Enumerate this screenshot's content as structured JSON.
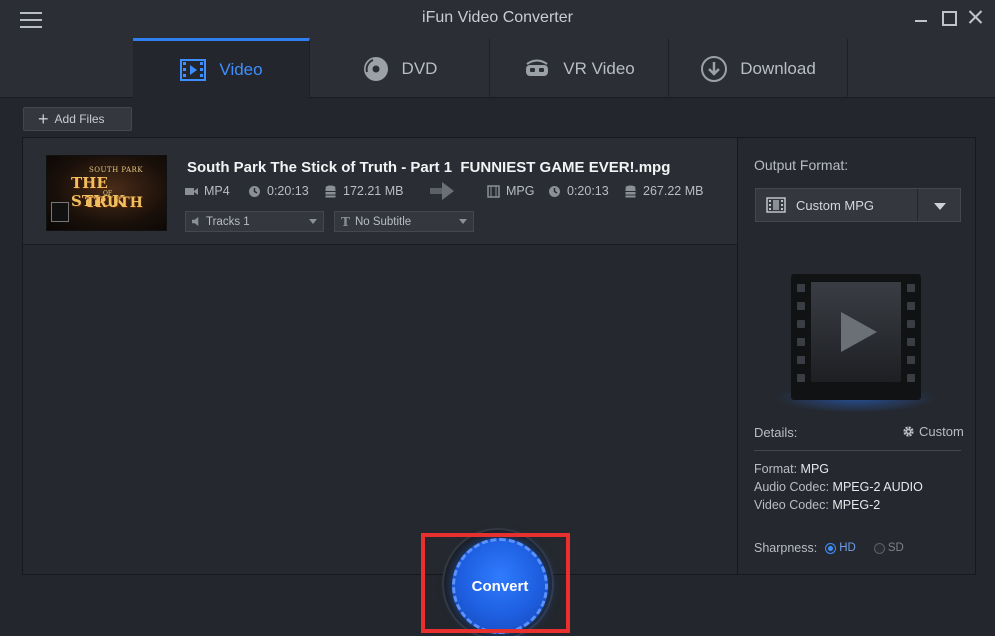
{
  "window": {
    "title": "iFun Video Converter"
  },
  "tabs": [
    {
      "label": "Video",
      "icon": "film-icon",
      "active": true
    },
    {
      "label": "DVD",
      "icon": "disc-icon"
    },
    {
      "label": "VR Video",
      "icon": "vr-headset-icon"
    },
    {
      "label": "Download",
      "icon": "download-icon"
    }
  ],
  "toolbar": {
    "add_files_label": "Add Files"
  },
  "file": {
    "name": "South Park The Stick of Truth - Part 1  FUNNIEST GAME EVER!.mpg",
    "thumbnail_text": [
      "SOUTH PARK",
      "THE STICK",
      "OF",
      "TRUTH"
    ],
    "source": {
      "format": "MP4",
      "duration": "0:20:13",
      "size": "172.21 MB"
    },
    "target": {
      "format": "MPG",
      "duration": "0:20:13",
      "size": "267.22 MB"
    },
    "audio_track": "Tracks 1",
    "subtitle": "No Subtitle"
  },
  "output": {
    "label": "Output Format:",
    "selected": "Custom MPG",
    "details_label": "Details:",
    "custom_label": "Custom",
    "format_key": "Format:",
    "format_value": "MPG",
    "audio_codec_key": "Audio Codec:",
    "audio_codec_value": "MPEG-2 AUDIO",
    "video_codec_key": "Video Codec:",
    "video_codec_value": "MPEG-2",
    "sharpness_label": "Sharpness:",
    "sharpness_options": [
      "HD",
      "SD"
    ],
    "sharpness_selected": "HD"
  },
  "convert": {
    "label": "Convert"
  },
  "colors": {
    "accent": "#2f7ff0",
    "highlight": "#e8302e",
    "background": "#23262c"
  }
}
